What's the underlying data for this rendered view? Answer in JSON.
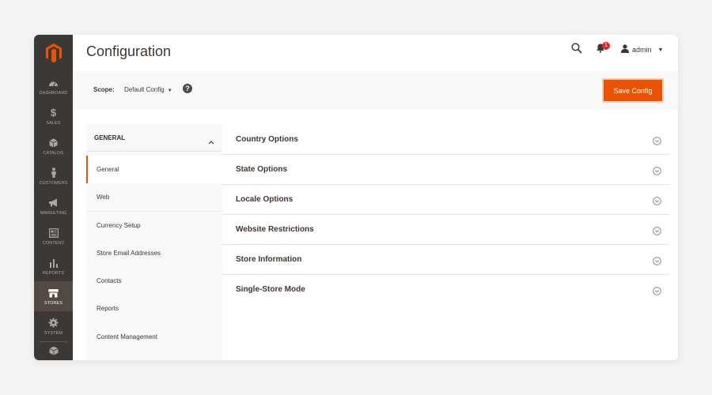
{
  "app": {
    "accent_color": "#eb5202",
    "nav_bg_color": "#3b3835"
  },
  "nav": {
    "logo_icon": "magento-logo-icon",
    "items": [
      {
        "label": "Dashboard",
        "icon": "dashboard-icon"
      },
      {
        "label": "Sales",
        "icon": "dollar-icon"
      },
      {
        "label": "Catalog",
        "icon": "box-icon"
      },
      {
        "label": "Customers",
        "icon": "person-icon"
      },
      {
        "label": "Marketing",
        "icon": "megaphone-icon"
      },
      {
        "label": "Content",
        "icon": "content-icon"
      },
      {
        "label": "Reports",
        "icon": "bar-chart-icon"
      },
      {
        "label": "Stores",
        "icon": "store-icon",
        "active": true
      },
      {
        "label": "System",
        "icon": "gear-icon"
      },
      {
        "label": "",
        "icon": "extensions-icon"
      }
    ]
  },
  "header": {
    "title": "Configuration",
    "notifications_count": "1",
    "user_name": "admin"
  },
  "scope": {
    "label": "Scope:",
    "value": "Default Config",
    "help": "?"
  },
  "toolbar": {
    "save_label": "Save Config"
  },
  "config_tabs": {
    "group_title": "GENERAL",
    "items": [
      {
        "label": "General",
        "active": true
      },
      {
        "label": "Web"
      },
      {
        "label": "Currency Setup"
      },
      {
        "label": "Store Email Addresses"
      },
      {
        "label": "Contacts"
      },
      {
        "label": "Reports"
      },
      {
        "label": "Content Management"
      }
    ]
  },
  "sections": [
    {
      "title": "Country Options"
    },
    {
      "title": "State Options"
    },
    {
      "title": "Locale Options"
    },
    {
      "title": "Website Restrictions"
    },
    {
      "title": "Store Information"
    },
    {
      "title": "Single-Store Mode"
    }
  ]
}
